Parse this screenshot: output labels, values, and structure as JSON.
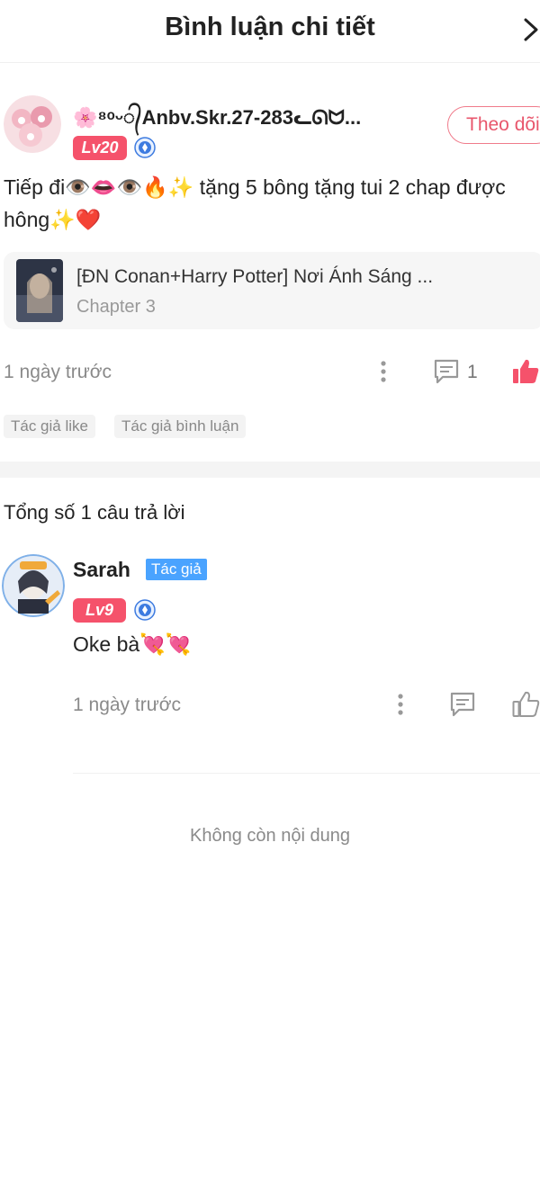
{
  "header": {
    "title": "Bình luận chi tiết",
    "next_icon": "chevron-right-icon"
  },
  "comment": {
    "username": "🌸⁸ᵒᵕ᭄Anbv.Skr.27-283ᓚᘏᗢ...",
    "level": "Lv20",
    "follow_label": "Theo dõi",
    "text": "Tiếp đi👁️👄👁️🔥✨ tặng 5 bông tặng tui 2 chap được hông✨❤️",
    "chapter_title": "[ĐN Conan+Harry Potter] Nơi Ánh Sáng ...",
    "chapter_sub": "Chapter 3",
    "time": "1 ngày trước",
    "reply_count": "1",
    "tags": [
      "Tác giả like",
      "Tác giả bình luận"
    ]
  },
  "replies_section": {
    "total_label": "Tổng số 1 câu trả lời"
  },
  "reply": {
    "username": "Sarah",
    "author_tag": "Tác giả",
    "level": "Lv9",
    "text": "Oke bà💘💘",
    "time": "1 ngày trước"
  },
  "footer": {
    "end_text": "Không còn nội dung"
  },
  "colors": {
    "accent_pink": "#f5526b",
    "author_blue": "#4aa3ff",
    "muted_gray": "#8a8a8a"
  }
}
